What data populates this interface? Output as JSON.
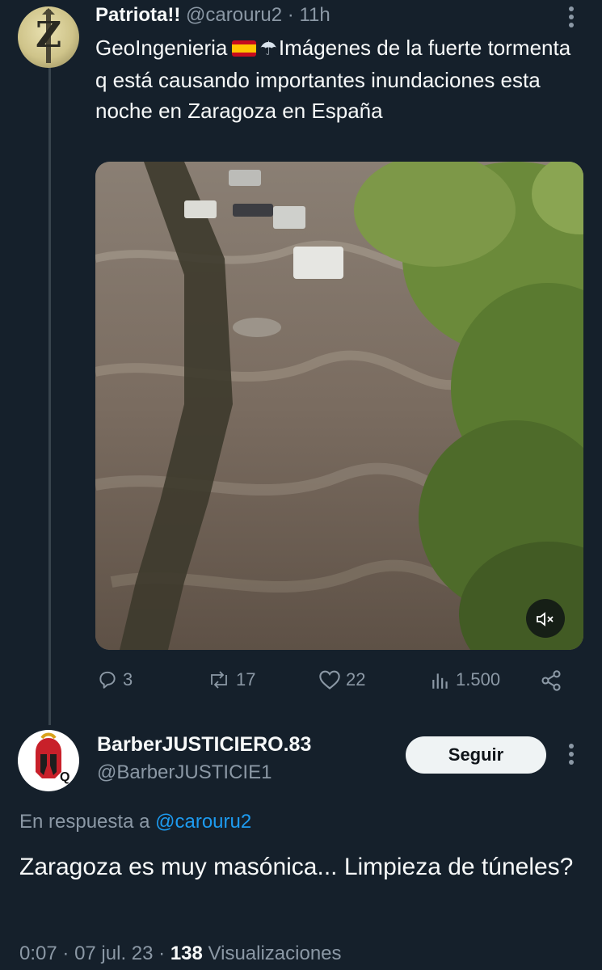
{
  "original_tweet": {
    "author_name": "Patriota!!",
    "handle": "@carouru2",
    "separator": "·",
    "time": "11h",
    "avatar_letter": "Z",
    "text_before_flag": "GeoIngenieria",
    "text_after_emoji": "Imágenes de la fuerte tormenta q está causando importantes inundaciones esta noche en Zaragoza en España",
    "actions": {
      "replies": "3",
      "retweets": "17",
      "likes": "22",
      "views": "1.500"
    }
  },
  "reply_tweet": {
    "author_name": "BarberJUSTICIERO.83",
    "handle": "@BarberJUSTICIE1",
    "avatar_letter": "Q",
    "follow_label": "Seguir",
    "reply_prefix": "En respuesta a",
    "reply_to_handle": "@carouru2",
    "text": "Zaragoza es muy masónica... Limpieza de túneles?",
    "meta": {
      "time": "0:07",
      "date": "07 jul. 23",
      "separator": "·",
      "views_count": "138",
      "views_label": "Visualizaciones"
    }
  },
  "icons": [
    "kebab-menu-icon",
    "spain-flag-icon",
    "rain-cloud-icon",
    "mute-icon",
    "reply-icon",
    "retweet-icon",
    "like-icon",
    "views-icon",
    "share-icon"
  ],
  "colors": {
    "background": "#15202b",
    "text": "#f7f9f9",
    "muted": "#8b98a5",
    "link": "#1d9bf0",
    "thread_line": "#38444d"
  }
}
